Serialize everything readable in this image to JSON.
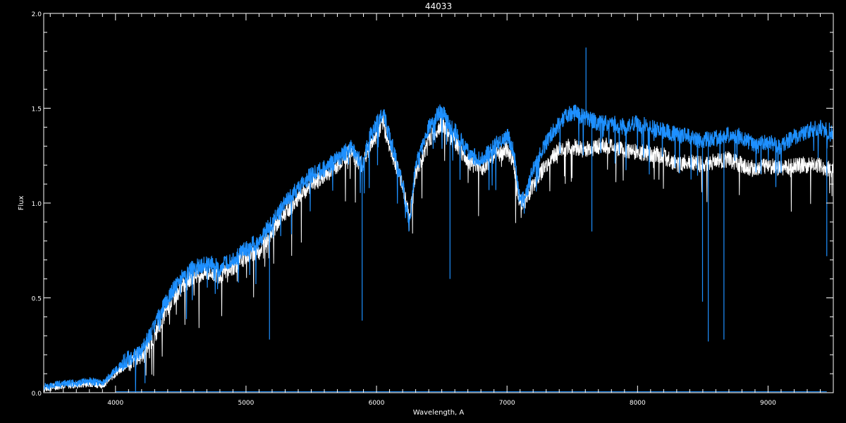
{
  "chart_data": {
    "type": "line",
    "title": "44033",
    "xlabel": "Wavelength, A",
    "ylabel": "Flux",
    "xlim": [
      3450,
      9500
    ],
    "ylim": [
      0.0,
      2.0
    ],
    "x_ticks": [
      4000,
      5000,
      6000,
      7000,
      8000,
      9000
    ],
    "x_tick_labels": [
      "4000",
      "5000",
      "6000",
      "7000",
      "8000",
      "9000"
    ],
    "y_ticks": [
      0.0,
      0.5,
      1.0,
      1.5,
      2.0
    ],
    "y_tick_labels": [
      "0.0",
      "0.5",
      "1.0",
      "1.5",
      "2.0"
    ],
    "grid": false,
    "background": "#000000",
    "axis_color": "#ffffff",
    "series": [
      {
        "color": "#ffffff",
        "x": [
          3450,
          3600,
          3700,
          3800,
          3900,
          4000,
          4100,
          4200,
          4300,
          4400,
          4500,
          4600,
          4700,
          4800,
          4900,
          5000,
          5100,
          5200,
          5300,
          5400,
          5500,
          5600,
          5700,
          5800,
          5890,
          5950,
          6050,
          6100,
          6200,
          6250,
          6300,
          6400,
          6500,
          6563,
          6600,
          6700,
          6800,
          6900,
          7000,
          7050,
          7100,
          7150,
          7200,
          7300,
          7400,
          7500,
          7600,
          7700,
          7800,
          7900,
          8000,
          8100,
          8200,
          8300,
          8400,
          8500,
          8600,
          8700,
          8800,
          8900,
          9000,
          9100,
          9200,
          9300,
          9400,
          9450
        ],
        "y": [
          0.02,
          0.04,
          0.04,
          0.05,
          0.04,
          0.1,
          0.15,
          0.2,
          0.3,
          0.45,
          0.55,
          0.62,
          0.63,
          0.62,
          0.66,
          0.72,
          0.75,
          0.85,
          0.95,
          1.02,
          1.1,
          1.14,
          1.2,
          1.27,
          1.2,
          1.3,
          1.42,
          1.3,
          1.1,
          0.92,
          1.15,
          1.33,
          1.42,
          1.35,
          1.32,
          1.22,
          1.18,
          1.25,
          1.28,
          1.22,
          1.0,
          1.02,
          1.1,
          1.2,
          1.28,
          1.3,
          1.28,
          1.3,
          1.3,
          1.28,
          1.27,
          1.26,
          1.25,
          1.2,
          1.22,
          1.2,
          1.22,
          1.23,
          1.2,
          1.18,
          1.2,
          1.18,
          1.2,
          1.2,
          1.2,
          1.18
        ]
      },
      {
        "color": "#1e90ff",
        "x": [
          3450,
          3600,
          3700,
          3800,
          3900,
          4000,
          4100,
          4200,
          4300,
          4400,
          4500,
          4600,
          4700,
          4800,
          4900,
          5000,
          5100,
          5200,
          5300,
          5400,
          5500,
          5600,
          5700,
          5800,
          5890,
          5950,
          6050,
          6100,
          6200,
          6250,
          6300,
          6400,
          6500,
          6563,
          6600,
          6700,
          6800,
          6900,
          7000,
          7050,
          7100,
          7150,
          7200,
          7300,
          7400,
          7500,
          7600,
          7700,
          7800,
          7900,
          8000,
          8100,
          8200,
          8300,
          8400,
          8500,
          8600,
          8700,
          8800,
          8900,
          9000,
          9100,
          9200,
          9300,
          9400,
          9450
        ],
        "y": [
          0.03,
          0.05,
          0.05,
          0.06,
          0.05,
          0.12,
          0.18,
          0.22,
          0.35,
          0.5,
          0.6,
          0.66,
          0.68,
          0.66,
          0.7,
          0.76,
          0.8,
          0.9,
          1.0,
          1.08,
          1.15,
          1.18,
          1.23,
          1.3,
          1.2,
          1.35,
          1.48,
          1.35,
          1.1,
          0.88,
          1.2,
          1.4,
          1.5,
          1.4,
          1.38,
          1.27,
          1.22,
          1.3,
          1.36,
          1.28,
          1.0,
          1.05,
          1.18,
          1.32,
          1.43,
          1.48,
          1.45,
          1.42,
          1.42,
          1.4,
          1.42,
          1.4,
          1.38,
          1.36,
          1.35,
          1.33,
          1.34,
          1.36,
          1.35,
          1.3,
          1.32,
          1.3,
          1.35,
          1.38,
          1.4,
          1.38
        ]
      }
    ],
    "absorption_lines": [
      {
        "x": 4226,
        "y": 0.05
      },
      {
        "x": 5180,
        "y": 0.28
      },
      {
        "x": 5890,
        "y": 0.38
      },
      {
        "x": 6563,
        "y": 0.6
      },
      {
        "x": 7650,
        "y": 0.85
      },
      {
        "x": 8498,
        "y": 0.48
      },
      {
        "x": 8542,
        "y": 0.27
      },
      {
        "x": 8662,
        "y": 0.28
      },
      {
        "x": 9450,
        "y": 0.72
      }
    ],
    "emission_peak": {
      "x": 7605,
      "y": 1.82
    }
  }
}
